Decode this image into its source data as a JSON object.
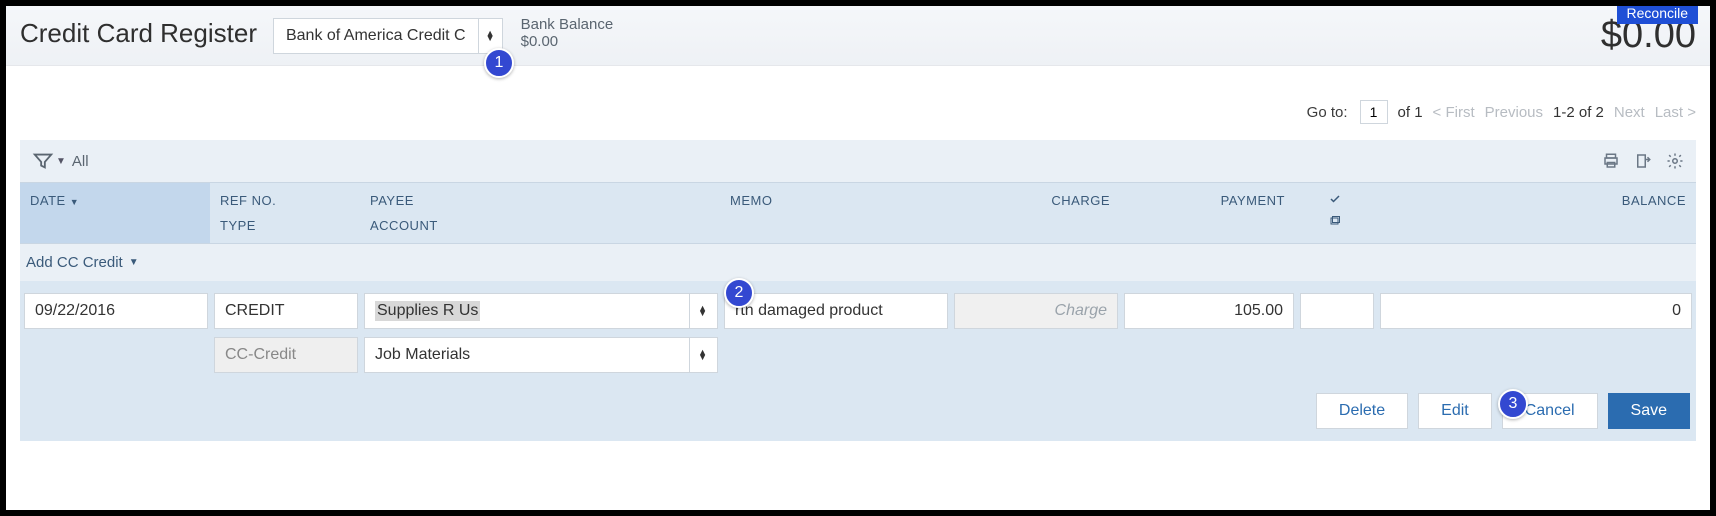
{
  "header": {
    "title": "Credit Card Register",
    "account_selected": "Bank of America Credit C",
    "bank_balance_label": "Bank Balance",
    "bank_balance_amount": "$0.00",
    "big_balance": "$0.00",
    "reconcile_label": "Reconcile"
  },
  "pager": {
    "goto_label": "Go to:",
    "page_value": "1",
    "of_label": "of 1",
    "first": "< First",
    "previous": "Previous",
    "range": "1-2 of 2",
    "next": "Next",
    "last": "Last >"
  },
  "toolbar": {
    "filter_label": "All"
  },
  "columns": {
    "date": "DATE",
    "ref1": "REF NO.",
    "ref2": "TYPE",
    "payee1": "PAYEE",
    "payee2": "ACCOUNT",
    "memo": "MEMO",
    "charge": "CHARGE",
    "payment": "PAYMENT",
    "balance": "BALANCE"
  },
  "addrow": {
    "label": "Add CC Credit"
  },
  "entry": {
    "date": "09/22/2016",
    "ref": "CREDIT",
    "type": "CC-Credit",
    "payee": "Supplies R Us",
    "account": "Job Materials",
    "memo": "rtn damaged product",
    "charge_placeholder": "Charge",
    "payment": "105.00",
    "balance": "0"
  },
  "actions": {
    "delete": "Delete",
    "edit": "Edit",
    "cancel": "Cancel",
    "save": "Save"
  },
  "callouts": {
    "c1": "1",
    "c2": "2",
    "c3": "3"
  }
}
